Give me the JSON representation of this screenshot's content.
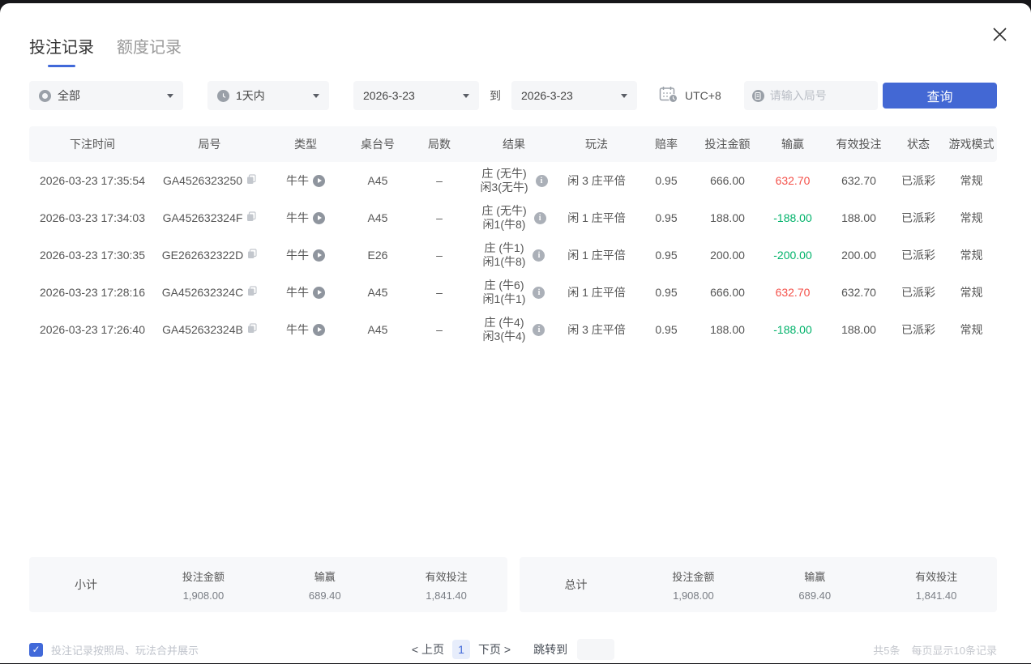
{
  "modal": {
    "tabs": [
      {
        "label": "投注记录"
      },
      {
        "label": "额度记录"
      }
    ]
  },
  "filters": {
    "type_select": "全部",
    "range_select": "1天内",
    "date_from": "2026-3-23",
    "to_label": "到",
    "date_to": "2026-3-23",
    "timezone": "UTC+8",
    "search_placeholder": "请输入局号",
    "query_button": "查询"
  },
  "table": {
    "headers": [
      "下注时间",
      "局号",
      "类型",
      "桌台号",
      "局数",
      "结果",
      "玩法",
      "赔率",
      "投注金额",
      "输赢",
      "有效投注",
      "状态",
      "游戏模式"
    ],
    "rows": [
      {
        "time": "2026-03-23 17:35:54",
        "round_id": "GA4526323250",
        "type": "牛牛",
        "table_no": "A45",
        "rounds": "–",
        "result_line1": "庄 (无牛)",
        "result_line2": "闲3(无牛)",
        "play": "闲 3 庄平倍",
        "odds": "0.95",
        "bet": "666.00",
        "winloss": "632.70",
        "win_class": "pos",
        "valid": "632.70",
        "status": "已派彩",
        "mode": "常规"
      },
      {
        "time": "2026-03-23 17:34:03",
        "round_id": "GA452632324F",
        "type": "牛牛",
        "table_no": "A45",
        "rounds": "–",
        "result_line1": "庄 (无牛)",
        "result_line2": "闲1(牛8)",
        "play": "闲 1 庄平倍",
        "odds": "0.95",
        "bet": "188.00",
        "winloss": "-188.00",
        "win_class": "neg",
        "valid": "188.00",
        "status": "已派彩",
        "mode": "常规"
      },
      {
        "time": "2026-03-23 17:30:35",
        "round_id": "GE262632322D",
        "type": "牛牛",
        "table_no": "E26",
        "rounds": "–",
        "result_line1": "庄 (牛1)",
        "result_line2": "闲1(牛8)",
        "play": "闲 1 庄平倍",
        "odds": "0.95",
        "bet": "200.00",
        "winloss": "-200.00",
        "win_class": "neg",
        "valid": "200.00",
        "status": "已派彩",
        "mode": "常规"
      },
      {
        "time": "2026-03-23 17:28:16",
        "round_id": "GA452632324C",
        "type": "牛牛",
        "table_no": "A45",
        "rounds": "–",
        "result_line1": "庄 (牛6)",
        "result_line2": "闲1(牛1)",
        "play": "闲 1 庄平倍",
        "odds": "0.95",
        "bet": "666.00",
        "winloss": "632.70",
        "win_class": "pos",
        "valid": "632.70",
        "status": "已派彩",
        "mode": "常规"
      },
      {
        "time": "2026-03-23 17:26:40",
        "round_id": "GA452632324B",
        "type": "牛牛",
        "table_no": "A45",
        "rounds": "–",
        "result_line1": "庄 (牛4)",
        "result_line2": "闲3(牛4)",
        "play": "闲 3 庄平倍",
        "odds": "0.95",
        "bet": "188.00",
        "winloss": "-188.00",
        "win_class": "neg",
        "valid": "188.00",
        "status": "已派彩",
        "mode": "常规"
      }
    ]
  },
  "summary": {
    "subtotal": {
      "label": "小计",
      "bet_label": "投注金额",
      "bet_value": "1,908.00",
      "winloss_label": "输赢",
      "winloss_value": "689.40",
      "valid_label": "有效投注",
      "valid_value": "1,841.40"
    },
    "total": {
      "label": "总计",
      "bet_label": "投注金额",
      "bet_value": "1,908.00",
      "winloss_label": "输赢",
      "winloss_value": "689.40",
      "valid_label": "有效投注",
      "valid_value": "1,841.40"
    }
  },
  "footer": {
    "checkbox_glyph": "✓",
    "merge_label": "投注记录按照局、玩法合并展示",
    "prev_label": "< 上页",
    "page": "1",
    "next_label": "下页 >",
    "jump_label": "跳转到",
    "total_count": "共5条",
    "page_size": "每页显示10条记录"
  },
  "colors": {
    "accent_blue": "#4368d4",
    "win_red": "#f4514a",
    "loss_green": "#00b26a"
  }
}
